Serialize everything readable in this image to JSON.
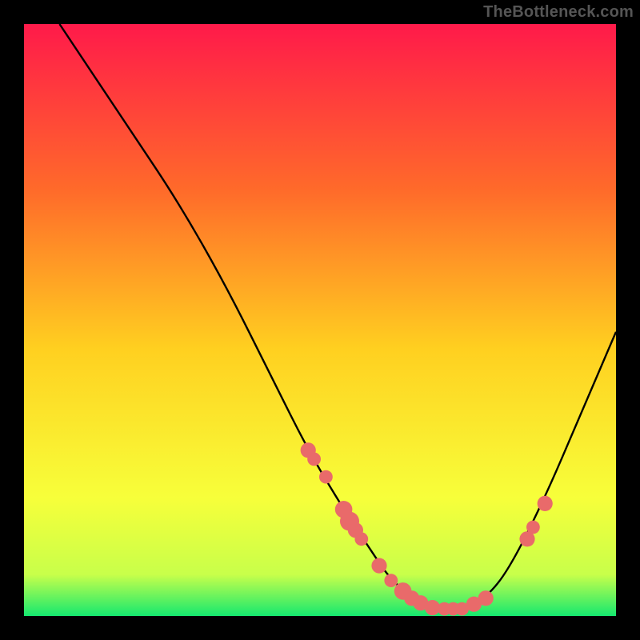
{
  "watermark": "TheBottleneck.com",
  "colors": {
    "bg_black": "#000000",
    "gradient_top": "#ff1a4a",
    "gradient_mid1": "#ff6a2a",
    "gradient_mid2": "#ffd020",
    "gradient_mid3": "#f7ff3a",
    "gradient_bottom_yellowgreen": "#c8ff4a",
    "gradient_bottom_green": "#15e86f",
    "curve_stroke": "#000000",
    "marker_fill": "#e96a6a",
    "marker_stroke": "#d14f4f"
  },
  "chart_data": {
    "type": "line",
    "title": "",
    "xlabel": "",
    "ylabel": "",
    "xlim": [
      0,
      100
    ],
    "ylim": [
      0,
      100
    ],
    "curve": [
      {
        "x": 6,
        "y": 100
      },
      {
        "x": 10,
        "y": 94
      },
      {
        "x": 18,
        "y": 82
      },
      {
        "x": 26,
        "y": 70
      },
      {
        "x": 34,
        "y": 56
      },
      {
        "x": 42,
        "y": 40
      },
      {
        "x": 48,
        "y": 28
      },
      {
        "x": 54,
        "y": 18
      },
      {
        "x": 58,
        "y": 12
      },
      {
        "x": 62,
        "y": 6
      },
      {
        "x": 66,
        "y": 3
      },
      {
        "x": 70,
        "y": 1.2
      },
      {
        "x": 74,
        "y": 1.2
      },
      {
        "x": 78,
        "y": 3
      },
      {
        "x": 82,
        "y": 8
      },
      {
        "x": 88,
        "y": 20
      },
      {
        "x": 94,
        "y": 34
      },
      {
        "x": 100,
        "y": 48
      }
    ],
    "markers": [
      {
        "x": 48,
        "y": 28,
        "r": 1.6
      },
      {
        "x": 49,
        "y": 26.5,
        "r": 1.4
      },
      {
        "x": 51,
        "y": 23.5,
        "r": 1.4
      },
      {
        "x": 54,
        "y": 18,
        "r": 1.8
      },
      {
        "x": 55,
        "y": 16,
        "r": 2.0
      },
      {
        "x": 56,
        "y": 14.5,
        "r": 1.6
      },
      {
        "x": 57,
        "y": 13,
        "r": 1.4
      },
      {
        "x": 60,
        "y": 8.5,
        "r": 1.6
      },
      {
        "x": 62,
        "y": 6,
        "r": 1.4
      },
      {
        "x": 64,
        "y": 4.2,
        "r": 1.8
      },
      {
        "x": 65.5,
        "y": 3,
        "r": 1.6
      },
      {
        "x": 67,
        "y": 2.2,
        "r": 1.6
      },
      {
        "x": 69,
        "y": 1.4,
        "r": 1.6
      },
      {
        "x": 71,
        "y": 1.2,
        "r": 1.4
      },
      {
        "x": 72.5,
        "y": 1.2,
        "r": 1.4
      },
      {
        "x": 74,
        "y": 1.2,
        "r": 1.4
      },
      {
        "x": 76,
        "y": 2,
        "r": 1.6
      },
      {
        "x": 78,
        "y": 3,
        "r": 1.6
      },
      {
        "x": 85,
        "y": 13,
        "r": 1.6
      },
      {
        "x": 86,
        "y": 15,
        "r": 1.4
      },
      {
        "x": 88,
        "y": 19,
        "r": 1.6
      }
    ]
  }
}
